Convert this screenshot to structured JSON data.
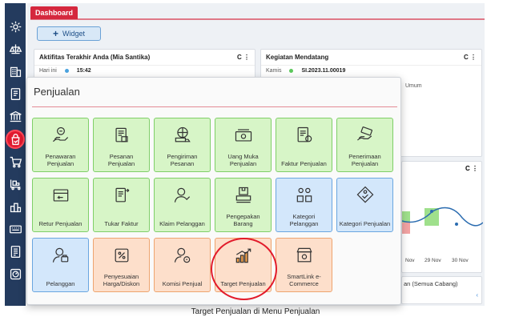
{
  "dashboard_tab": "Dashboard",
  "widget_button": "Widget",
  "activity_card": {
    "title": "Aktifitas Terakhir Anda (Mia Santika)",
    "day": "Hari ini",
    "time": "15:42"
  },
  "upcoming_card": {
    "title": "Kegiatan Mendatang",
    "day": "Kamis",
    "code": "SI.2023.11.00019",
    "note": "Umum"
  },
  "chart_card": {
    "x_labels": [
      "Nov",
      "29 Nov",
      "30 Nov"
    ]
  },
  "bottom_card": {
    "title_fragment": "an (Semua Cabang)"
  },
  "modal": {
    "title": "Penjualan",
    "tiles": [
      {
        "label": "Penawaran Penjualan",
        "icon": "quotation-icon"
      },
      {
        "label": "Pesanan Penjualan",
        "icon": "sales-order-icon"
      },
      {
        "label": "Pengiriman Pesanan",
        "icon": "delivery-icon"
      },
      {
        "label": "Uang Muka Penjualan",
        "icon": "down-payment-icon"
      },
      {
        "label": "Faktur Penjualan",
        "icon": "invoice-icon"
      },
      {
        "label": "Penerimaan Penjualan",
        "icon": "receipt-icon"
      },
      {
        "label": "Retur Penjualan",
        "icon": "return-icon"
      },
      {
        "label": "Tukar Faktur",
        "icon": "exchange-invoice-icon"
      },
      {
        "label": "Klaim Pelanggan",
        "icon": "customer-claim-icon"
      },
      {
        "label": "Pengepakan Barang",
        "icon": "packing-icon"
      },
      {
        "label": "Kategori Pelanggan",
        "icon": "customer-category-icon"
      },
      {
        "label": "Kategori Penjualan",
        "icon": "sales-category-icon"
      },
      {
        "label": "Pelanggan",
        "icon": "customer-icon"
      },
      {
        "label": "Penyesuaian Harga/Diskon",
        "icon": "price-adjustment-icon"
      },
      {
        "label": "Komisi Penjual",
        "icon": "commission-icon"
      },
      {
        "label": "Target Penjualan",
        "icon": "sales-target-icon"
      },
      {
        "label": "SmartLink e-Commerce",
        "icon": "ecommerce-store-icon"
      }
    ]
  },
  "caption": "Target Penjualan di Menu Penjualan",
  "colors": {
    "accent_red": "#d5283e",
    "sidebar": "#243b5e",
    "tile_green": "#d7f5c7",
    "tile_blue": "#d3e7fb",
    "tile_orange": "#fddfcb",
    "highlight_circle": "#e21b2b"
  }
}
